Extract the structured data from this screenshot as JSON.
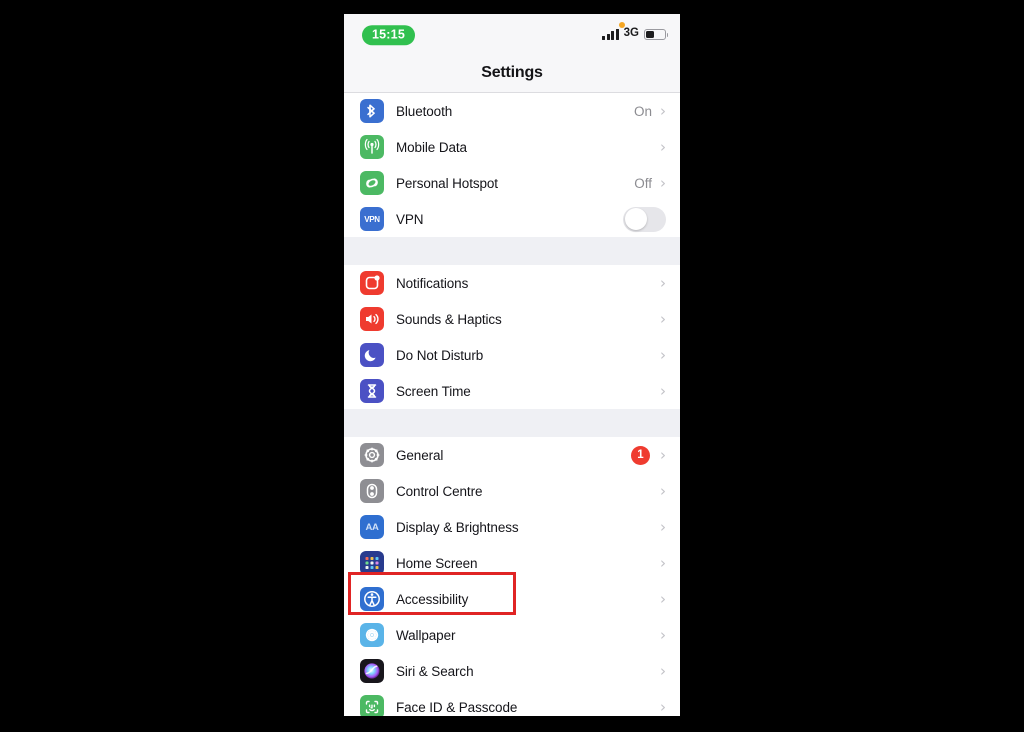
{
  "status_bar": {
    "time": "15:15",
    "time_pill_color": "#31c04f",
    "network": "3G",
    "signal_bars": 4,
    "recording_dot_color": "#f5a623",
    "battery_level_percent": 40
  },
  "nav": {
    "title": "Settings"
  },
  "highlight": {
    "target": "Accessibility",
    "color": "#e02424"
  },
  "groups": [
    {
      "id": "connectivity",
      "rows": [
        {
          "label": "Bluetooth",
          "icon": "bluetooth-icon",
          "value": "On",
          "accessory": "chevron"
        },
        {
          "label": "Mobile Data",
          "icon": "mobile-data-icon",
          "value": "",
          "accessory": "chevron"
        },
        {
          "label": "Personal Hotspot",
          "icon": "personal-hotspot-icon",
          "value": "Off",
          "accessory": "chevron"
        },
        {
          "label": "VPN",
          "icon": "vpn-icon",
          "value": "",
          "accessory": "toggle",
          "toggle_on": false
        }
      ]
    },
    {
      "id": "alerts",
      "rows": [
        {
          "label": "Notifications",
          "icon": "notifications-icon",
          "value": "",
          "accessory": "chevron"
        },
        {
          "label": "Sounds & Haptics",
          "icon": "sounds-haptics-icon",
          "value": "",
          "accessory": "chevron"
        },
        {
          "label": "Do Not Disturb",
          "icon": "do-not-disturb-icon",
          "value": "",
          "accessory": "chevron"
        },
        {
          "label": "Screen Time",
          "icon": "screen-time-icon",
          "value": "",
          "accessory": "chevron"
        }
      ]
    },
    {
      "id": "system",
      "rows": [
        {
          "label": "General",
          "icon": "general-icon",
          "value": "",
          "accessory": "chevron",
          "badge": "1"
        },
        {
          "label": "Control Centre",
          "icon": "control-centre-icon",
          "value": "",
          "accessory": "chevron"
        },
        {
          "label": "Display & Brightness",
          "icon": "display-brightness-icon",
          "value": "",
          "accessory": "chevron"
        },
        {
          "label": "Home Screen",
          "icon": "home-screen-icon",
          "value": "",
          "accessory": "chevron"
        },
        {
          "label": "Accessibility",
          "icon": "accessibility-icon",
          "value": "",
          "accessory": "chevron",
          "highlighted": true
        },
        {
          "label": "Wallpaper",
          "icon": "wallpaper-icon",
          "value": "",
          "accessory": "chevron"
        },
        {
          "label": "Siri & Search",
          "icon": "siri-search-icon",
          "value": "",
          "accessory": "chevron"
        },
        {
          "label": "Face ID & Passcode",
          "icon": "face-id-passcode-icon",
          "value": "",
          "accessory": "chevron"
        }
      ]
    }
  ]
}
